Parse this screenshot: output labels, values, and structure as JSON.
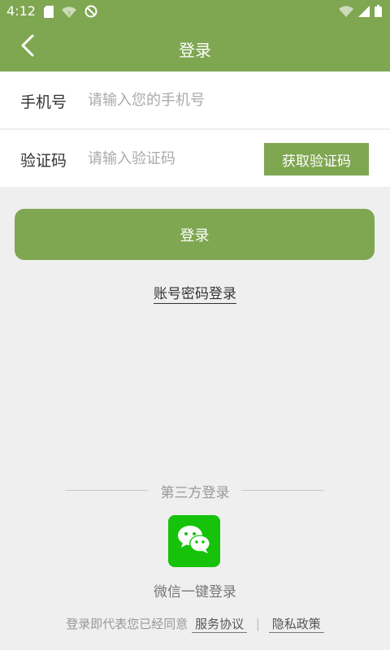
{
  "status_bar": {
    "time": "4:12"
  },
  "app_bar": {
    "title": "登录"
  },
  "form": {
    "phone": {
      "label": "手机号",
      "placeholder": "请输入您的手机号",
      "value": ""
    },
    "code": {
      "label": "验证码",
      "placeholder": "请输入验证码",
      "value": "",
      "get_code_label": "获取验证码"
    }
  },
  "login_button": "登录",
  "password_login": "账号密码登录",
  "third_party": {
    "title": "第三方登录",
    "wechat_label": "微信一键登录"
  },
  "agreement": {
    "prefix": "登录即代表您已经同意",
    "terms": "服务协议",
    "separator": "|",
    "privacy": "隐私政策"
  },
  "colors": {
    "primary": "#7fa651",
    "wechat": "#16c20a",
    "background": "#efefef"
  }
}
